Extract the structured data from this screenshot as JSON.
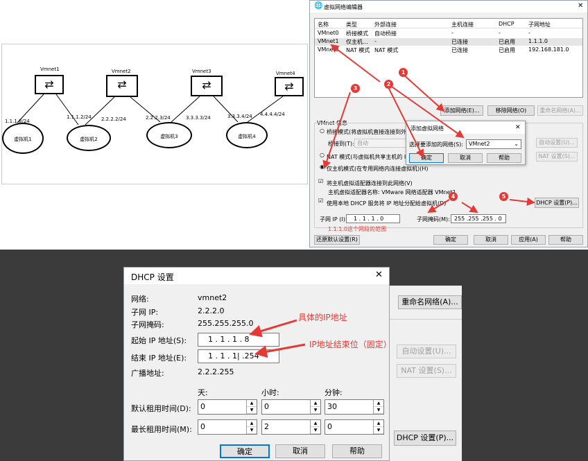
{
  "diagram": {
    "switches": [
      "Vmnet1",
      "Vmnet2",
      "Vmnet3",
      "Vmnet4"
    ],
    "vms": [
      "虚拟机1",
      "虚拟机2",
      "虚拟机3",
      "虚拟机4"
    ],
    "links": [
      "1.1.1.8/24",
      "1.1.1.2/24",
      "2.2.2.2/24",
      "2.2.2.3/24",
      "3.3.3.3/24",
      "3.3.3.4/24",
      "4.4.4.4/24"
    ]
  },
  "vne": {
    "title": "虚拟网络编辑器",
    "headers": [
      "名称",
      "类型",
      "外部连接",
      "主机连接",
      "DHCP",
      "子网地址"
    ],
    "rows": [
      [
        "VMnet0",
        "桥接模式",
        "自动桥接",
        "-",
        "-",
        "-"
      ],
      [
        "VMnet1",
        "仅主机...",
        "-",
        "已连接",
        "已启用",
        "1.1.1.0"
      ],
      [
        "VMnet8",
        "NAT 模式",
        "NAT 模式",
        "已连接",
        "已启用",
        "192.168.181.0"
      ]
    ],
    "add_net": "添加网络(E)...",
    "remove_net": "移除网络(O)",
    "rename_net": "重命名网络(A)...",
    "vmnet_info": "VMnet 信息",
    "bridge_mode": "桥接模式(将虚拟机直接连接到外部网络)(B)",
    "bridge_to": "桥接到(T):",
    "bridge_to_value": "自动",
    "auto_settings": "自动设置(U)...",
    "nat_mode": "NAT 模式(与虚拟机共享主机的 IP 地址)(N)",
    "nat_settings": "NAT 设置(S)...",
    "host_only": "仅主机模式(在专用网络内连接虚拟机)(H)",
    "connect_adapter": "将主机虚拟适配器连接到此网络(V)",
    "adapter_name": "主机虚拟适配器名称: VMware 网络适配器 VMnet1",
    "use_dhcp": "使用本地 DHCP 服务将 IP 地址分配给虚拟机(D)",
    "dhcp_settings": "DHCP 设置(P)...",
    "subnet_ip_label": "子网 IP (I):",
    "subnet_ip_value": "1 . 1 . 1 . 0",
    "subnet_mask_label": "子网掩码(M):",
    "subnet_mask_value": "255 .255 .255 . 0",
    "restore": "还原默认设置(R)",
    "ok": "确定",
    "cancel": "取消",
    "apply": "应用(A)",
    "help": "帮助"
  },
  "addnet": {
    "title": "添加虚拟网络",
    "select_label": "选择要添加的网络(S):",
    "select_value": "VMnet2",
    "ok": "确定",
    "cancel": "取消",
    "help": "帮助"
  },
  "annotations": {
    "note1": "1.1.1.0这个网段的范围",
    "note2": "具体的IP地址",
    "note3": "IP地址结束位（固定）",
    "circles": [
      "1",
      "2",
      "3",
      "4",
      "5"
    ]
  },
  "dhcp": {
    "title": "DHCP 设置",
    "network_label": "网络:",
    "network_value": "vmnet2",
    "subnet_ip_label": "子网 IP:",
    "subnet_ip_value": "2.2.2.0",
    "subnet_mask_label": "子网掩码:",
    "subnet_mask_value": "255.255.255.0",
    "start_label": "起始 IP 地址(S):",
    "start_value": "1 . 1 . 1 . 8",
    "end_label": "结束 IP 地址(E):",
    "end_value": "1 . 1 . 1| .254",
    "broadcast_label": "广播地址:",
    "broadcast_value": "2.2.2.255",
    "days": "天:",
    "hours": "小时:",
    "minutes": "分钟:",
    "default_lease": "默认租用时间(D):",
    "max_lease": "最长租用时间(M):",
    "default_values": [
      "0",
      "0",
      "30"
    ],
    "max_values": [
      "0",
      "2",
      "0"
    ],
    "ok": "确定",
    "cancel": "取消",
    "help": "帮助"
  },
  "bg": {
    "rename_net": "重命名网络(A)...",
    "auto_settings": "自动设置(U)...",
    "nat_settings": "NAT 设置(S)...",
    "dhcp_settings": "DHCP 设置(P)..."
  }
}
